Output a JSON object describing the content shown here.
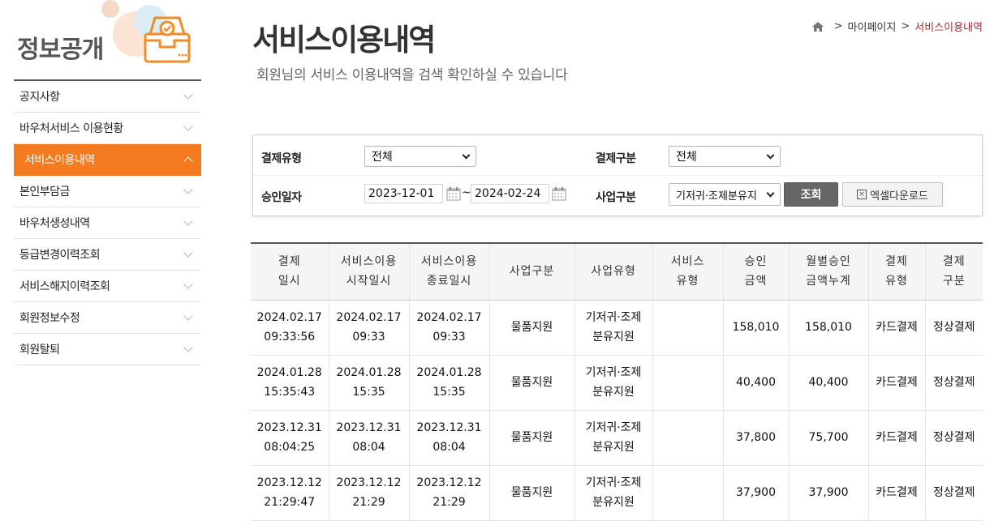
{
  "sidebar": {
    "title": "정보공개",
    "items": [
      {
        "label": "공지사항"
      },
      {
        "label": "바우처서비스 이용현황"
      },
      {
        "label": "서비스이용내역"
      },
      {
        "label": "본인부담금"
      },
      {
        "label": "바우처생성내역"
      },
      {
        "label": "등급변경이력조회"
      },
      {
        "label": "서비스해지이력조회"
      },
      {
        "label": "회원정보수정"
      },
      {
        "label": "회원탈퇴"
      }
    ],
    "active_index": 2
  },
  "header": {
    "title": "서비스이용내역",
    "description": "회원님의 서비스 이용내역을 검색 확인하실 수 있습니다",
    "breadcrumb": [
      "마이페이지",
      "서비스이용내역"
    ]
  },
  "search": {
    "payment_type_label": "결제유형",
    "payment_type_value": "전체",
    "payment_class_label": "결제구분",
    "payment_class_value": "전체",
    "approval_date_label": "승인일자",
    "date_from": "2023-12-01",
    "date_sep": "~",
    "date_to": "2024-02-24",
    "business_class_label": "사업구분",
    "business_class_value": "기저귀·조제분유지",
    "search_button": "조회",
    "excel_button": "엑셀다운로드"
  },
  "table": {
    "headers": [
      [
        "결제",
        "일시"
      ],
      [
        "서비스이용",
        "시작일시"
      ],
      [
        "서비스이용",
        "종료일시"
      ],
      [
        "사업구분",
        ""
      ],
      [
        "사업유형",
        ""
      ],
      [
        "서비스",
        "유형"
      ],
      [
        "승인",
        "금액"
      ],
      [
        "월별승인",
        "금액누계"
      ],
      [
        "결제",
        "유형"
      ],
      [
        "결제",
        "구분"
      ]
    ],
    "rows": [
      {
        "pay_date": "2024.02.17",
        "pay_time": "09:33:56",
        "start_date": "2024.02.17",
        "start_time": "09:33",
        "end_date": "2024.02.17",
        "end_time": "09:33",
        "biz_class": "물품지원",
        "biz_type_1": "기저귀·조제",
        "biz_type_2": "분유지원",
        "svc_type": "",
        "amount": "158,010",
        "monthly_total": "158,010",
        "pay_type": "카드결제",
        "pay_class": "정상결제"
      },
      {
        "pay_date": "2024.01.28",
        "pay_time": "15:35:43",
        "start_date": "2024.01.28",
        "start_time": "15:35",
        "end_date": "2024.01.28",
        "end_time": "15:35",
        "biz_class": "물품지원",
        "biz_type_1": "기저귀·조제",
        "biz_type_2": "분유지원",
        "svc_type": "",
        "amount": "40,400",
        "monthly_total": "40,400",
        "pay_type": "카드결제",
        "pay_class": "정상결제"
      },
      {
        "pay_date": "2023.12.31",
        "pay_time": "08:04:25",
        "start_date": "2023.12.31",
        "start_time": "08:04",
        "end_date": "2023.12.31",
        "end_time": "08:04",
        "biz_class": "물품지원",
        "biz_type_1": "기저귀·조제",
        "biz_type_2": "분유지원",
        "svc_type": "",
        "amount": "37,800",
        "monthly_total": "75,700",
        "pay_type": "카드결제",
        "pay_class": "정상결제"
      },
      {
        "pay_date": "2023.12.12",
        "pay_time": "21:29:47",
        "start_date": "2023.12.12",
        "start_time": "21:29",
        "end_date": "2023.12.12",
        "end_time": "21:29",
        "biz_class": "물품지원",
        "biz_type_1": "기저귀·조제",
        "biz_type_2": "분유지원",
        "svc_type": "",
        "amount": "37,900",
        "monthly_total": "37,900",
        "pay_type": "카드결제",
        "pay_class": "정상결제"
      }
    ]
  },
  "colors": {
    "accent": "#f47b20",
    "breadcrumb_current": "#b3262b",
    "search_button": "#666666"
  }
}
